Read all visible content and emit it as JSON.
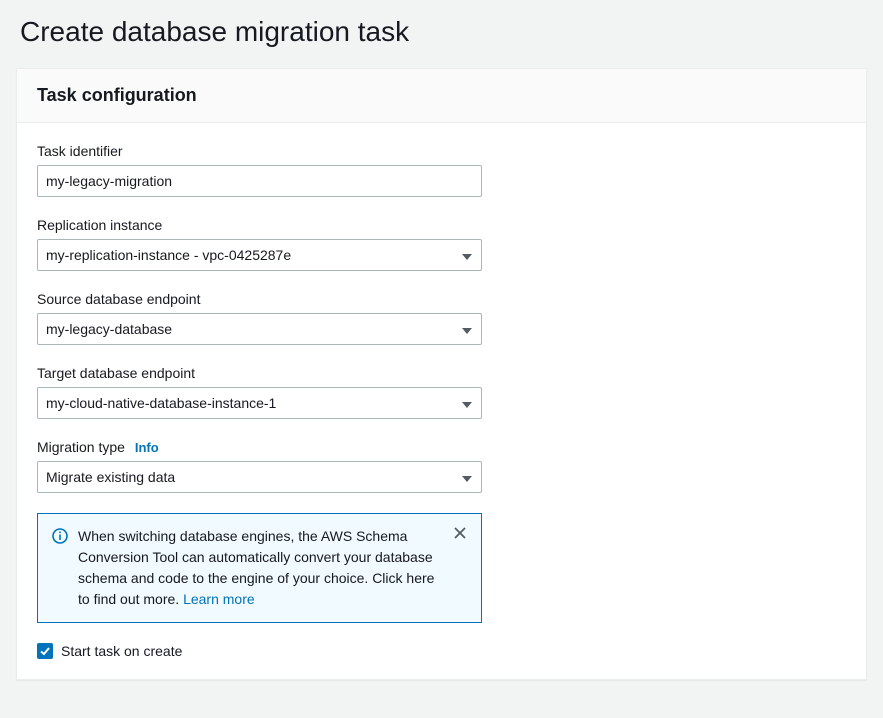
{
  "page_title": "Create database migration task",
  "section_title": "Task configuration",
  "fields": {
    "task_identifier": {
      "label": "Task identifier",
      "value": "my-legacy-migration"
    },
    "replication_instance": {
      "label": "Replication instance",
      "value": "my-replication-instance - vpc-0425287e"
    },
    "source_endpoint": {
      "label": "Source database endpoint",
      "value": "my-legacy-database"
    },
    "target_endpoint": {
      "label": "Target database endpoint",
      "value": "my-cloud-native-database-instance-1"
    },
    "migration_type": {
      "label": "Migration type",
      "info_label": "Info",
      "value": "Migrate existing data"
    }
  },
  "info_box": {
    "text": "When switching database engines, the AWS Schema Conversion Tool can automatically convert your database schema and code to the engine of your choice. Click here to find out more. ",
    "learn_more": "Learn more"
  },
  "checkbox": {
    "label": "Start task on create",
    "checked": true
  }
}
